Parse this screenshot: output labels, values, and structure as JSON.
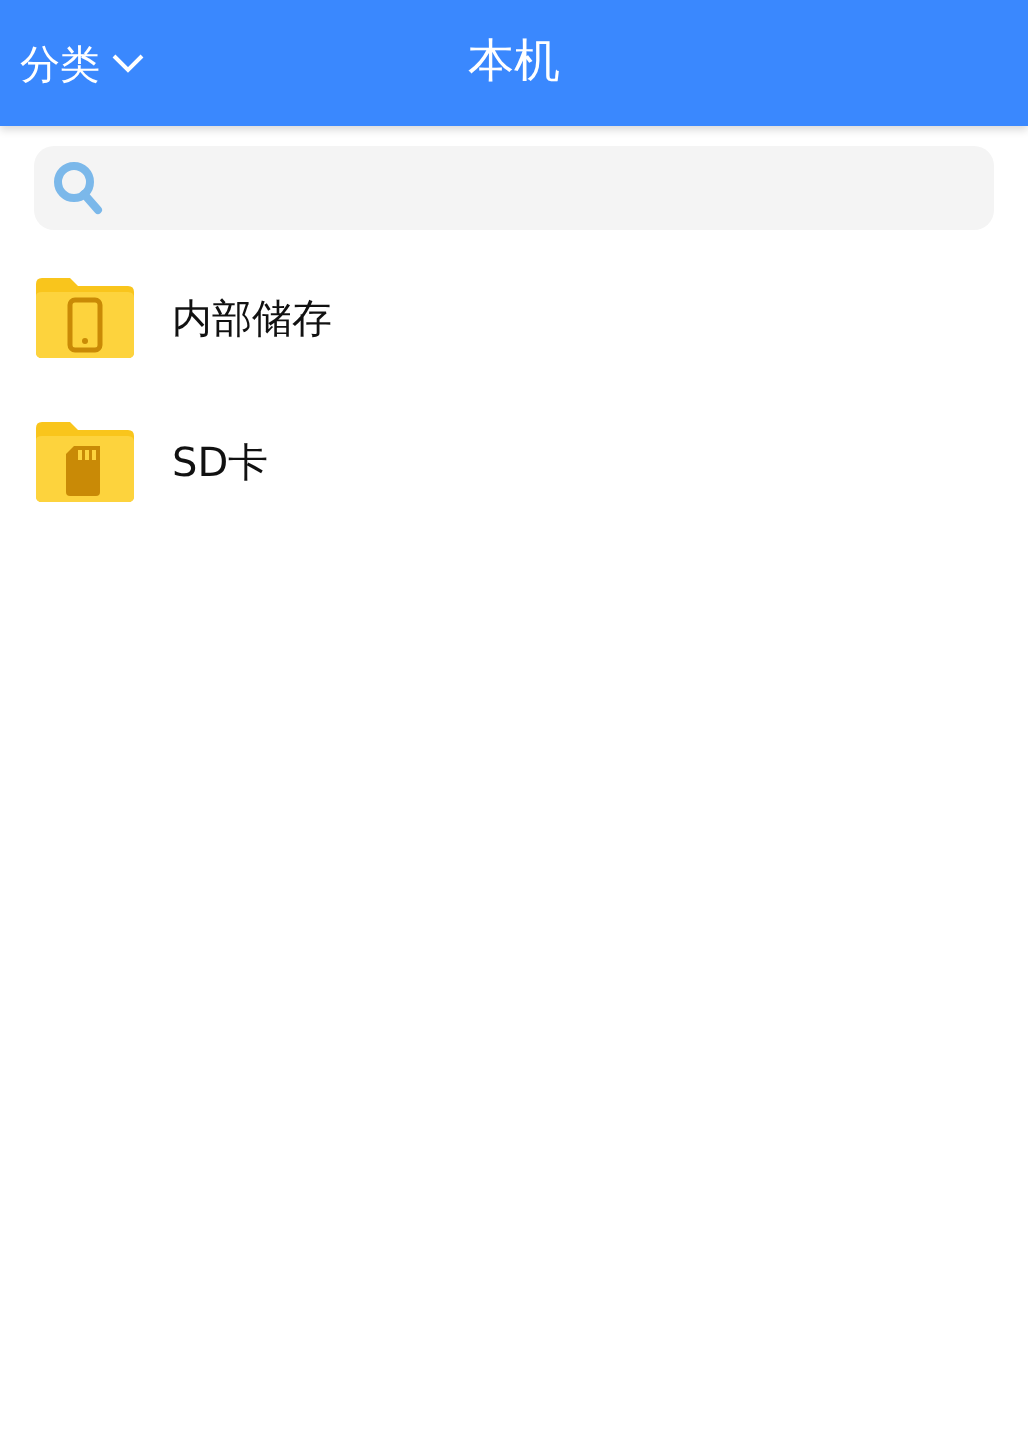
{
  "header": {
    "menu_label": "分类",
    "title": "本机"
  },
  "items": [
    {
      "kind": "phone",
      "label": "内部储存"
    },
    {
      "kind": "sdcard",
      "label": "SD卡"
    }
  ]
}
